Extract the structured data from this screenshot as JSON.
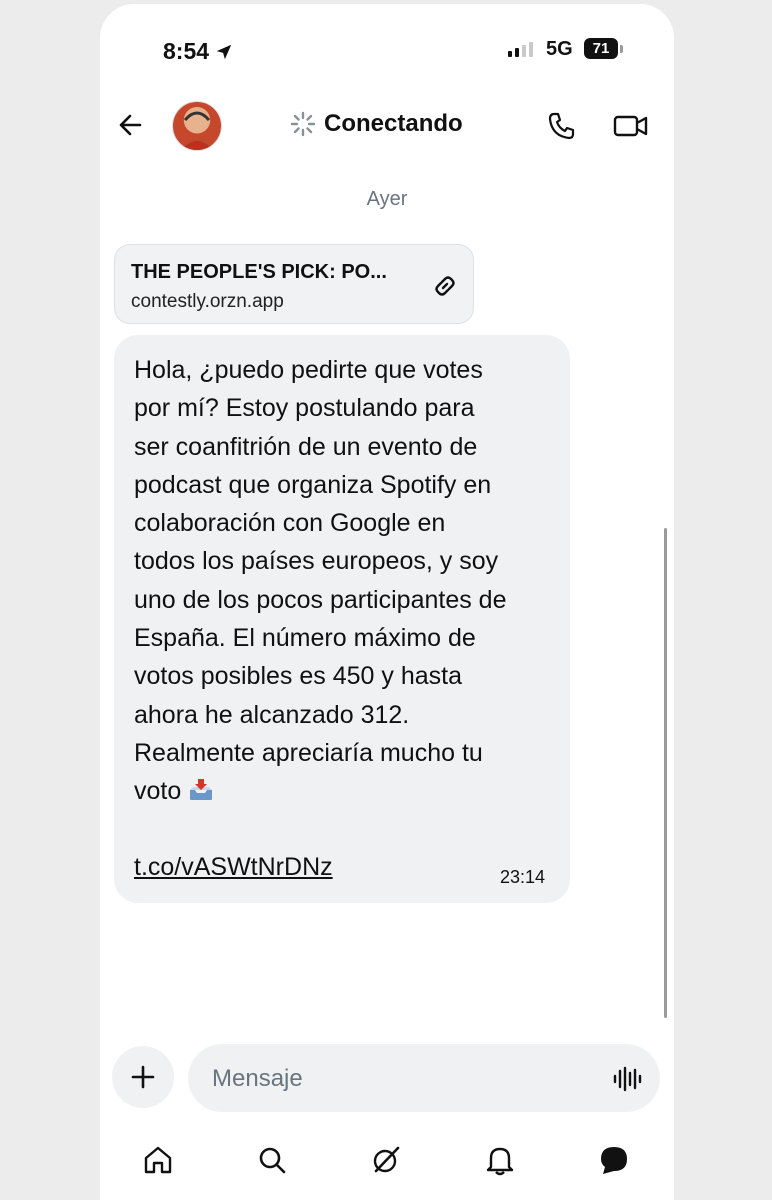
{
  "status_bar": {
    "time": "8:54",
    "network": "5G",
    "battery": "71"
  },
  "header": {
    "title": "Conectando",
    "icons": [
      "back-arrow-icon",
      "loading-spinner-icon",
      "phone-icon",
      "video-icon"
    ]
  },
  "conversation": {
    "day_separator": "Ayer",
    "link_preview": {
      "title": "THE PEOPLE'S PICK: PO...",
      "domain": "contestly.orzn.app"
    },
    "message": {
      "text": "Hola, ¿puedo pedirte que votes\npor mí? Estoy postulando para\nser coanfitrión de un evento de\npodcast que organiza Spotify en\ncolaboración con Google en\ntodos los países europeos, y soy\nuno de los pocos participantes de\nEspaña. El número máximo de\nvotos posibles es 450 y hasta\nahora he alcanzado 312.\nRealmente apreciaría mucho tu\nvoto ",
      "emoji": "inbox-tray-icon",
      "link": "t.co/vASWtNrDNz",
      "time": "23:14"
    }
  },
  "composer": {
    "placeholder": "Mensaje"
  },
  "tabbar": {
    "items": [
      "home-icon",
      "search-icon",
      "grok-icon",
      "notifications-icon",
      "messages-icon"
    ]
  },
  "colors": {
    "bubble": "#eff1f2",
    "text": "#111111",
    "muted": "#6a7480"
  }
}
